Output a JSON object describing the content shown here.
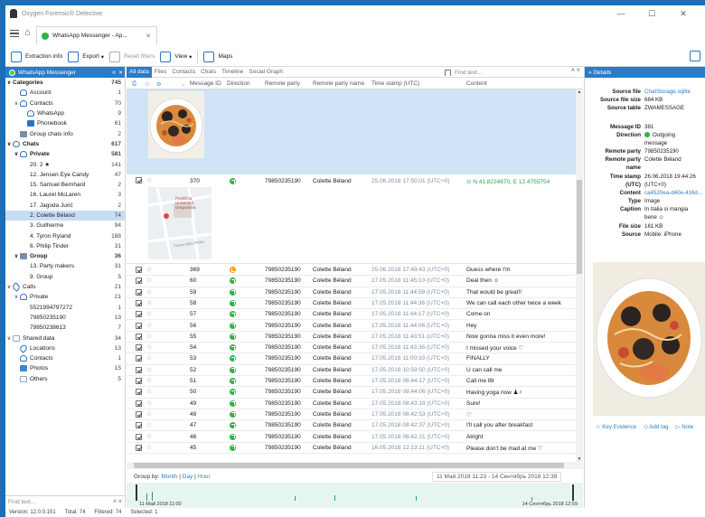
{
  "window": {
    "title": "Oxygen Forensic® Detective",
    "minimize": "—",
    "maximize": "☐",
    "close": "✕"
  },
  "tab": {
    "label": "WhatsApp Messenger - Ap...",
    "close": "✕"
  },
  "toolbar": {
    "extraction_info": "Extraction info",
    "export": "Export",
    "reset_filters": "Reset filters",
    "view": "View",
    "maps": "Maps"
  },
  "sidebar": {
    "header": "WhatsApp Messenger",
    "collapse": "«",
    "close": "✕",
    "items": [
      {
        "label": "Categories",
        "count": "745",
        "indent": 0,
        "chev": "∨",
        "icon": "",
        "bold": true
      },
      {
        "label": "Account",
        "count": "1",
        "indent": 1,
        "chev": "",
        "icon": "person",
        "bold": false
      },
      {
        "label": "Contacts",
        "count": "70",
        "indent": 1,
        "chev": "∨",
        "icon": "person",
        "bold": false
      },
      {
        "label": "WhatsApp",
        "count": "9",
        "indent": 2,
        "chev": "",
        "icon": "person",
        "bold": false
      },
      {
        "label": "Phonebook",
        "count": "61",
        "indent": 2,
        "chev": "",
        "icon": "blue",
        "bold": false
      },
      {
        "label": "Group chats info",
        "count": "2",
        "indent": 1,
        "chev": "",
        "icon": "group",
        "bold": false
      },
      {
        "label": "Chats",
        "count": "617",
        "indent": 0,
        "chev": "∨",
        "icon": "bubble",
        "bold": true
      },
      {
        "label": "Private",
        "count": "581",
        "indent": 1,
        "chev": "∨",
        "icon": "person",
        "bold": true
      },
      {
        "label": "20. 2 ★",
        "count": "141",
        "indent": 2,
        "chev": "",
        "icon": "",
        "bold": false
      },
      {
        "label": "12. Jensen Eye Candy",
        "count": "47",
        "indent": 2,
        "chev": "",
        "icon": "",
        "bold": false
      },
      {
        "label": "15. Samuel Bernhard",
        "count": "2",
        "indent": 2,
        "chev": "",
        "icon": "",
        "bold": false
      },
      {
        "label": "16. Laurel McLaren",
        "count": "3",
        "indent": 2,
        "chev": "",
        "icon": "",
        "bold": false
      },
      {
        "label": "17. Jagoda Jurić",
        "count": "2",
        "indent": 2,
        "chev": "",
        "icon": "",
        "bold": false
      },
      {
        "label": "2. Colette Béland",
        "count": "74",
        "indent": 2,
        "chev": "",
        "icon": "",
        "bold": false,
        "selected": true
      },
      {
        "label": "3. Guilherme",
        "count": "94",
        "indent": 2,
        "chev": "",
        "icon": "",
        "bold": false
      },
      {
        "label": "4. Tyron Ryland",
        "count": "188",
        "indent": 2,
        "chev": "",
        "icon": "",
        "bold": false
      },
      {
        "label": "6. Philip Tinder",
        "count": "31",
        "indent": 2,
        "chev": "",
        "icon": "",
        "bold": false
      },
      {
        "label": "Group",
        "count": "36",
        "indent": 1,
        "chev": "∨",
        "icon": "group",
        "bold": true
      },
      {
        "label": "13. Party makers",
        "count": "31",
        "indent": 2,
        "chev": "",
        "icon": "",
        "bold": false
      },
      {
        "label": "9. Group",
        "count": "5",
        "indent": 2,
        "chev": "",
        "icon": "",
        "bold": false
      },
      {
        "label": "Calls",
        "count": "21",
        "indent": 0,
        "chev": "∨",
        "icon": "phone",
        "bold": false
      },
      {
        "label": "Private",
        "count": "21",
        "indent": 1,
        "chev": "∨",
        "icon": "person",
        "bold": false
      },
      {
        "label": "5521994797272",
        "count": "1",
        "indent": 2,
        "chev": "",
        "icon": "",
        "bold": false
      },
      {
        "label": "79850235190",
        "count": "13",
        "indent": 2,
        "chev": "",
        "icon": "",
        "bold": false
      },
      {
        "label": "79850238613",
        "count": "7",
        "indent": 2,
        "chev": "",
        "icon": "",
        "bold": false
      },
      {
        "label": "Shared data",
        "count": "34",
        "indent": 0,
        "chev": "∨",
        "icon": "files",
        "bold": false
      },
      {
        "label": "Locations",
        "count": "13",
        "indent": 1,
        "chev": "",
        "icon": "pin",
        "bold": false
      },
      {
        "label": "Contacts",
        "count": "1",
        "indent": 1,
        "chev": "",
        "icon": "person",
        "bold": false
      },
      {
        "label": "Photos",
        "count": "15",
        "indent": 1,
        "chev": "",
        "icon": "photo",
        "bold": false
      },
      {
        "label": "Others",
        "count": "5",
        "indent": 1,
        "chev": "",
        "icon": "files",
        "bold": false
      }
    ],
    "find_placeholder": "Find text...",
    "find_arrows": "˄ ˅"
  },
  "status": {
    "version": "Version: 12.0.0.151",
    "total": "Total: 74",
    "filtered": "Filtered: 74",
    "selected": "Selected: 1"
  },
  "subtabs": [
    "All data",
    "Files",
    "Contacts",
    "Chats",
    "Timeline",
    "Social Graph"
  ],
  "find": {
    "placeholder": "Find text...",
    "arrows": "˄ ˅"
  },
  "columns": {
    "message_id": "Message ID",
    "direction": "Direction",
    "remote_party": "Remote party",
    "remote_party_name": "Remote party name",
    "timestamp": "Time stamp (UTC)",
    "content": "Content"
  },
  "location_row": {
    "id": "370",
    "party": "79850235190",
    "name": "Colette Béland",
    "time": "25.06.2018 17:50:01 (UTC+0)",
    "content": "N 41.8224670, E 12.4755754",
    "map_label": "Pontificia Università Gregoriana",
    "map_label2": "Piazza della Pilotta"
  },
  "rows": [
    {
      "id": "369",
      "dir": "in",
      "party": "79850235190",
      "name": "Colette Béland",
      "time": "25.06.2018 17:49:43 (UTC+0)",
      "content": "Guess where I'm"
    },
    {
      "id": "60",
      "dir": "out",
      "party": "79850235190",
      "name": "Colette Béland",
      "time": "17.05.2018 11:45:10 (UTC+0)",
      "content": "Deal then ☺"
    },
    {
      "id": "59",
      "dir": "out",
      "party": "79850235190",
      "name": "Colette Béland",
      "time": "17.05.2018 11:44:59 (UTC+0)",
      "content": "That would be great!!"
    },
    {
      "id": "58",
      "dir": "out",
      "party": "79850235190",
      "name": "Colette Béland",
      "time": "17.05.2018 11:44:36 (UTC+0)",
      "content": "We can call each other twice a week"
    },
    {
      "id": "57",
      "dir": "out",
      "party": "79850235190",
      "name": "Colette Béland",
      "time": "17.05.2018 11:44:17 (UTC+0)",
      "content": "Come on"
    },
    {
      "id": "56",
      "dir": "out",
      "party": "79850235190",
      "name": "Colette Béland",
      "time": "17.05.2018 11:44:06 (UTC+0)",
      "content": "Hey"
    },
    {
      "id": "55",
      "dir": "out",
      "party": "79850235190",
      "name": "Colette Béland",
      "time": "17.05.2018 11:43:51 (UTC+0)",
      "content": "Now gonna miss it even more!"
    },
    {
      "id": "54",
      "dir": "out",
      "party": "79850235190",
      "name": "Colette Béland",
      "time": "17.05.2018 11:43:36 (UTC+0)",
      "content": "I missed your voice ♡"
    },
    {
      "id": "53",
      "dir": "out",
      "party": "79850235190",
      "name": "Colette Béland",
      "time": "17.05.2018 11:00:33 (UTC+0)",
      "content": "FINALLY"
    },
    {
      "id": "52",
      "dir": "out",
      "party": "79850235190",
      "name": "Colette Béland",
      "time": "17.05.2018 10:59:50 (UTC+0)",
      "content": "U can call me"
    },
    {
      "id": "51",
      "dir": "out",
      "party": "79850235190",
      "name": "Colette Béland",
      "time": "17.05.2018 08:44:17 (UTC+0)",
      "content": "Call me l8r"
    },
    {
      "id": "50",
      "dir": "out",
      "party": "79850235190",
      "name": "Colette Béland",
      "time": "17.05.2018 08:44:06 (UTC+0)",
      "content": "Having yoga now ♟♀"
    },
    {
      "id": "49",
      "dir": "out",
      "party": "79850235190",
      "name": "Colette Béland",
      "time": "17.05.2018 08:43:18 (UTC+0)",
      "content": "Sure!"
    },
    {
      "id": "48",
      "dir": "out",
      "party": "79850235190",
      "name": "Colette Béland",
      "time": "17.05.2018 08:42:53 (UTC+0)",
      "content": "♡"
    },
    {
      "id": "47",
      "dir": "out",
      "party": "79850235190",
      "name": "Colette Béland",
      "time": "17.05.2018 08:42:37 (UTC+0)",
      "content": "I'll call you after breakfast"
    },
    {
      "id": "46",
      "dir": "out",
      "party": "79850235190",
      "name": "Colette Béland",
      "time": "17.05.2018 08:42:21 (UTC+0)",
      "content": "Alright"
    },
    {
      "id": "45",
      "dir": "out",
      "party": "79850235190",
      "name": "Colette Béland",
      "time": "16.05.2018 12:13:11 (UTC+0)",
      "content": "Please don't be mad at me ♡"
    }
  ],
  "groupby": {
    "label": "Group by:",
    "month": "Month",
    "day": "Day",
    "hour": "Hour",
    "range": "11 Май 2018 11:23 - 14 Сентябрь 2018 12:39",
    "tl_start": "11 Май 2018 11:00",
    "tl_end": "14 Сентябрь 2018 12:59"
  },
  "details": {
    "header": "Details",
    "collapse": "»",
    "fields": [
      {
        "k": "Source file",
        "v": "ChatStorage.sqlite",
        "link": true
      },
      {
        "k": "Source file size",
        "v": "664 KB",
        "link": false
      },
      {
        "k": "Source table",
        "v": "ZWAMESSAGE",
        "link": false
      },
      {
        "k": "Message ID",
        "v": "381",
        "link": false
      },
      {
        "k": "Direction",
        "v": "Outgoing",
        "link": false
      },
      {
        "k": "",
        "v": "message",
        "link": false
      },
      {
        "k": "Remote party",
        "v": "79850235190",
        "link": false
      },
      {
        "k": "Remote party",
        "v": "Colette Béland",
        "link": false
      },
      {
        "k": "name",
        "v": "",
        "link": false
      },
      {
        "k": "Time stamp",
        "v": "26.06.2018 19:44:26",
        "link": false
      },
      {
        "k": "(UTC)",
        "v": "(UTC+0)",
        "link": false
      },
      {
        "k": "Content",
        "v": "ca4520ea-d40e-416d...",
        "link": true
      },
      {
        "k": "Type",
        "v": "Image",
        "link": false
      },
      {
        "k": "Caption",
        "v": "In Italia si mangia",
        "link": false
      },
      {
        "k": "",
        "v": "bene ☺",
        "link": false
      },
      {
        "k": "File size",
        "v": "161 KB",
        "link": false
      },
      {
        "k": "Source",
        "v": "Mobile: iPhone",
        "link": false
      }
    ],
    "key_evidence": "Key Evidence",
    "add_tag": "Add tag",
    "note": "Note"
  }
}
